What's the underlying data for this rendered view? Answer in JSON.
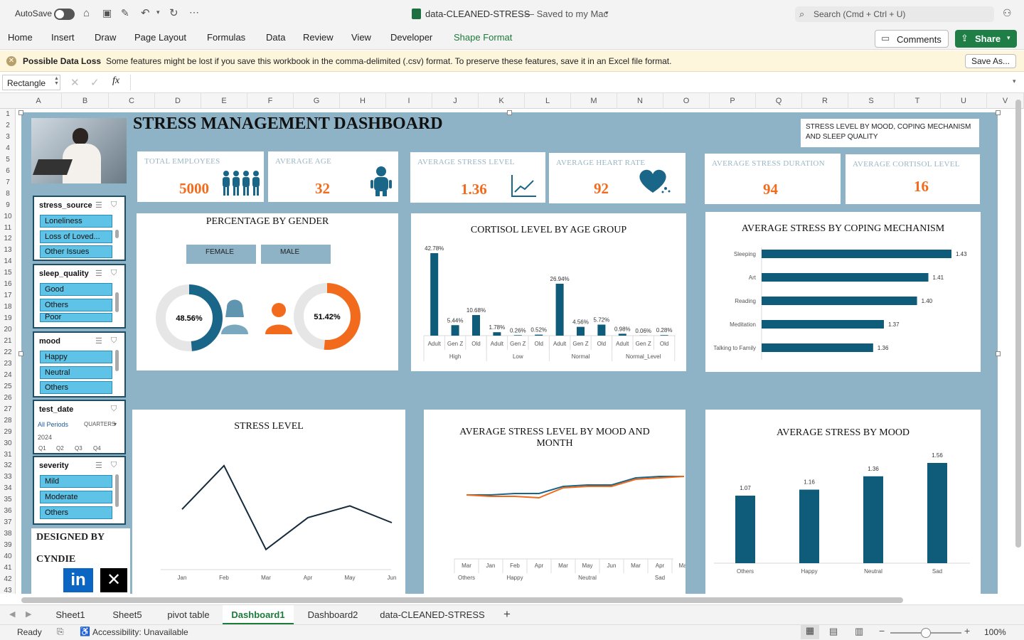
{
  "titlebar": {
    "autosave": "AutoSave",
    "file_title": "data-CLEANED-STRESS",
    "saved_state": "— Saved to my Mac",
    "search_placeholder": "Search (Cmd + Ctrl + U)"
  },
  "ribbon": {
    "tabs": [
      "Home",
      "Insert",
      "Draw",
      "Page Layout",
      "Formulas",
      "Data",
      "Review",
      "View",
      "Developer",
      "Shape Format"
    ],
    "active_tab": "Shape Format",
    "comments": "Comments",
    "share": "Share"
  },
  "message_bar": {
    "title": "Possible Data Loss",
    "text": "Some features might be lost if you save this workbook in the comma-delimited (.csv) format. To preserve these features, save it in an Excel file format.",
    "button": "Save As..."
  },
  "formula_bar": {
    "name_box": "Rectangle",
    "fx": "fx",
    "value": ""
  },
  "columns": [
    "A",
    "B",
    "C",
    "D",
    "E",
    "F",
    "G",
    "H",
    "I",
    "J",
    "K",
    "L",
    "M",
    "N",
    "O",
    "P",
    "Q",
    "R",
    "S",
    "T",
    "U",
    "V"
  ],
  "rows": [
    "1",
    "2",
    "3",
    "4",
    "5",
    "6",
    "7",
    "8",
    "9",
    "10",
    "11",
    "12",
    "13",
    "14",
    "15",
    "16",
    "17",
    "18",
    "19",
    "20",
    "21",
    "22",
    "23",
    "24",
    "25",
    "26",
    "27",
    "28",
    "29",
    "30",
    "31",
    "32",
    "33",
    "34",
    "35",
    "36",
    "37",
    "38",
    "39",
    "40",
    "41",
    "42",
    "43"
  ],
  "dashboard": {
    "title": "STRESS MANAGEMENT DASHBOARD",
    "note": "STRESS LEVEL BY MOOD,  COPING MECHANISM AND SLEEP QUALITY",
    "kpis": [
      {
        "label": "TOTAL EMPLOYEES",
        "value": "5000"
      },
      {
        "label": "AVERAGE AGE",
        "value": "32"
      },
      {
        "label": "AVERAGE STRESS LEVEL",
        "value": "1.36"
      },
      {
        "label": "AVERAGE HEART RATE",
        "value": "92"
      },
      {
        "label": "AVERAGE STRESS DURATION",
        "value": "94"
      },
      {
        "label": "AVERAGE CORTISOL LEVEL",
        "value": "16"
      }
    ],
    "designed_by": "DESIGNED BY",
    "designer": "CYNDIE",
    "slicers": {
      "stress_source": {
        "title": "stress_source",
        "items": [
          "Loneliness",
          "Loss of Loved...",
          "Other Issues"
        ]
      },
      "sleep_quality": {
        "title": "sleep_quality",
        "items": [
          "Good",
          "Others",
          "Poor"
        ]
      },
      "mood": {
        "title": "mood",
        "items": [
          "Happy",
          "Neutral",
          "Others"
        ]
      },
      "test_date": {
        "title": "test_date",
        "all_periods": "All Periods",
        "period_type": "QUARTERS",
        "year": "2024",
        "quarters": [
          "Q1",
          "Q2",
          "Q3",
          "Q4"
        ]
      },
      "severity": {
        "title": "severity",
        "items": [
          "Mild",
          "Moderate",
          "Others"
        ]
      }
    }
  },
  "chart_data": [
    {
      "type": "pie",
      "title": "PERCENTAGE BY GENDER",
      "legend": [
        "FEMALE",
        "MALE"
      ],
      "categories": [
        "FEMALE",
        "MALE"
      ],
      "values": [
        48.56,
        51.42
      ],
      "labels": [
        "48.56%",
        "51.42%"
      ],
      "colors": [
        "#1a6689",
        "#f26b1d"
      ]
    },
    {
      "type": "bar",
      "title": "CORTISOL LEVEL BY AGE GROUP",
      "groups": [
        "High",
        "Low",
        "Normal",
        "Normal_Level"
      ],
      "categories": [
        "Adult",
        "Gen Z",
        "Old",
        "Adult",
        "Gen Z",
        "Old",
        "Adult",
        "Gen Z",
        "Old",
        "Adult",
        "Gen Z",
        "Old"
      ],
      "values": [
        42.78,
        5.44,
        10.68,
        1.78,
        0.26,
        0.52,
        26.94,
        4.56,
        5.72,
        0.98,
        0.06,
        0.28
      ],
      "labels": [
        "42.78%",
        "5.44%",
        "10.68%",
        "1.78%",
        "0.26%",
        "0.52%",
        "26.94%",
        "4.56%",
        "5.72%",
        "0.98%",
        "0.06%",
        "0.28%"
      ],
      "color": "#0e5b7a"
    },
    {
      "type": "bar",
      "orientation": "horizontal",
      "title": "AVERAGE STRESS BY COPING MECHANISM",
      "categories": [
        "Sleeping",
        "Art",
        "Reading",
        "Meditation",
        "Talking to Family"
      ],
      "values": [
        1.43,
        1.41,
        1.4,
        1.37,
        1.36
      ],
      "labels": [
        "1.43",
        "1.41",
        "1.40",
        "1.37",
        "1.36"
      ],
      "color": "#0e5b7a"
    },
    {
      "type": "line",
      "title": "STRESS LEVEL",
      "categories": [
        "Jan",
        "Feb",
        "Mar",
        "Apr",
        "May",
        "Jun"
      ],
      "values": [
        1.36,
        1.62,
        1.12,
        1.31,
        1.38,
        1.28
      ],
      "color": "#142a3b"
    },
    {
      "type": "line",
      "title": "AVERAGE STRESS LEVEL BY MOOD AND MONTH",
      "groups": [
        "Others",
        "Happy",
        "Neutral",
        "Sad"
      ],
      "categories": [
        "Mar",
        "Jan",
        "Feb",
        "Apr",
        "Mar",
        "May",
        "Jun",
        "Mar",
        "Apr",
        "May"
      ],
      "series": [
        {
          "values": [
            1.3,
            1.3,
            1.31,
            1.31,
            1.36,
            1.37,
            1.37,
            1.42,
            1.43,
            1.43
          ],
          "color": "#1a6689"
        },
        {
          "values": [
            1.3,
            1.29,
            1.29,
            1.28,
            1.35,
            1.36,
            1.36,
            1.41,
            1.42,
            1.43
          ],
          "color": "#f26b1d"
        }
      ]
    },
    {
      "type": "bar",
      "title": "AVERAGE STRESS BY MOOD",
      "categories": [
        "Others",
        "Happy",
        "Neutral",
        "Sad"
      ],
      "values": [
        1.07,
        1.16,
        1.36,
        1.56
      ],
      "labels": [
        "1.07",
        "1.16",
        "1.36",
        "1.56"
      ],
      "color": "#0e5b7a"
    }
  ],
  "sheet_tabs": [
    "Sheet1",
    "Sheet5",
    "pivot table",
    "Dashboard1",
    "Dashboard2",
    "data-CLEANED-STRESS"
  ],
  "active_sheet": "Dashboard1",
  "status": {
    "ready": "Ready",
    "accessibility": "Accessibility: Unavailable",
    "zoom": "100%"
  }
}
